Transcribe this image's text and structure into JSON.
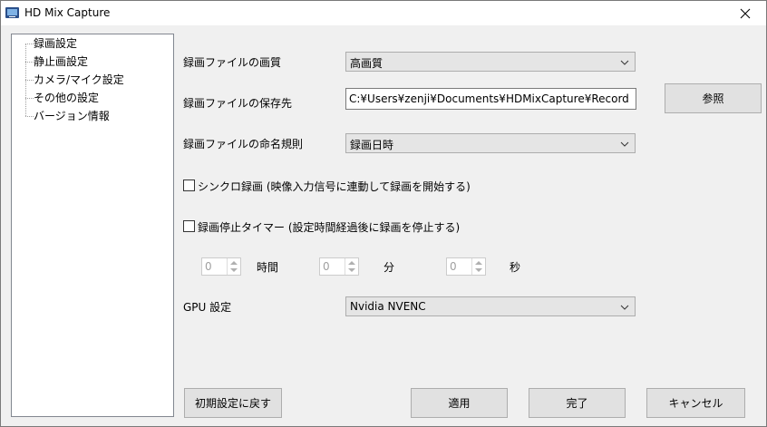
{
  "window": {
    "title": "HD Mix Capture"
  },
  "sidebar": {
    "items": [
      {
        "label": "録画設定"
      },
      {
        "label": "静止画設定"
      },
      {
        "label": "カメラ/マイク設定"
      },
      {
        "label": "その他の設定"
      },
      {
        "label": "バージョン情報"
      }
    ]
  },
  "settings": {
    "quality_label": "録画ファイルの画質",
    "quality_value": "高画質",
    "save_path_label": "録画ファイルの保存先",
    "save_path_value": "C:¥Users¥zenji¥Documents¥HDMixCapture¥Record",
    "browse_label": "参照",
    "naming_label": "録画ファイルの命名規則",
    "naming_value": "録画日時",
    "sync_label": "シンクロ録画 (映像入力信号に連動して録画を開始する)",
    "timer_label": "録画停止タイマー (設定時間経過後に録画を停止する)",
    "hours_value": "0",
    "hours_unit": "時間",
    "minutes_value": "0",
    "minutes_unit": "分",
    "seconds_value": "0",
    "seconds_unit": "秒",
    "gpu_label": "GPU 設定",
    "gpu_value": "Nvidia NVENC"
  },
  "footer": {
    "reset_label": "初期設定に戻す",
    "apply_label": "適用",
    "done_label": "完了",
    "cancel_label": "キャンセル"
  }
}
